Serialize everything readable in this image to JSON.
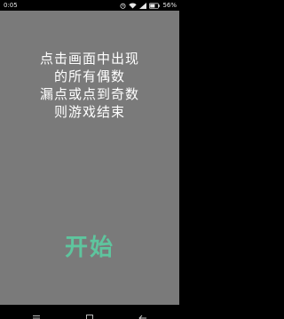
{
  "status_bar": {
    "time": "0:05",
    "battery_text": "56%",
    "icons": [
      "alarm-icon",
      "wifi-icon",
      "signal-icon",
      "battery-icon"
    ]
  },
  "instructions": [
    "点击画面中出现",
    "的所有偶数",
    "漏点或点到奇数",
    "则游戏结束"
  ],
  "start_label": "开始",
  "colors": {
    "background": "#7a7a7a",
    "text": "#ffffff",
    "start": "#5ec59e"
  },
  "nav_bar": {
    "icons": [
      "menu-icon",
      "home-icon",
      "back-icon"
    ]
  }
}
